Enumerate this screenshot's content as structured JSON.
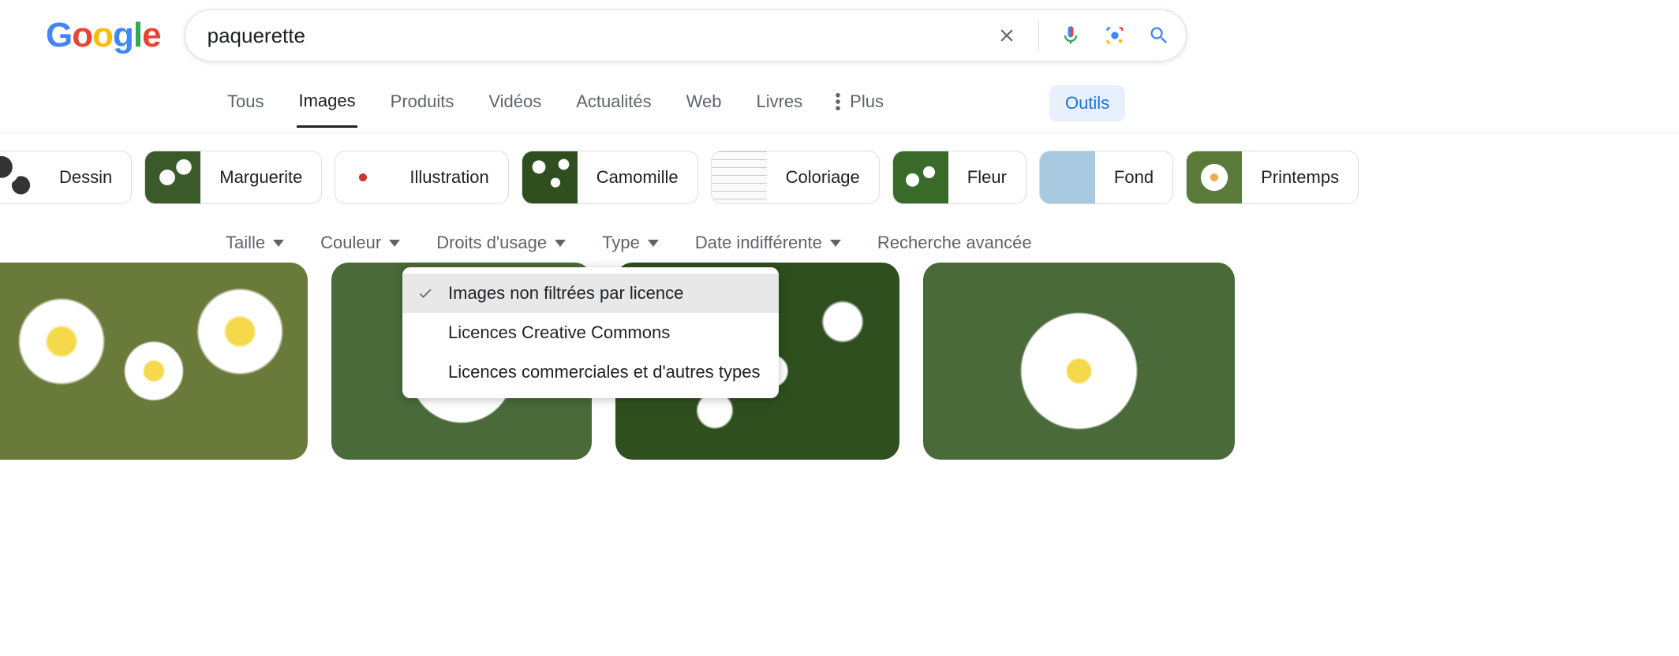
{
  "search": {
    "query": "paquerette"
  },
  "tabs": {
    "all": "Tous",
    "images": "Images",
    "products": "Produits",
    "videos": "Vidéos",
    "news": "Actualités",
    "web": "Web",
    "books": "Livres",
    "more": "Plus",
    "tools": "Outils"
  },
  "chips": [
    {
      "label": "Dessin"
    },
    {
      "label": "Marguerite"
    },
    {
      "label": "Illustration"
    },
    {
      "label": "Camomille"
    },
    {
      "label": "Coloriage"
    },
    {
      "label": "Fleur"
    },
    {
      "label": "Fond"
    },
    {
      "label": "Printemps"
    }
  ],
  "filters": {
    "size": "Taille",
    "color": "Couleur",
    "rights": "Droits d'usage",
    "type": "Type",
    "date": "Date indifférente",
    "advanced": "Recherche avancée"
  },
  "rights_dropdown": {
    "unfiltered": "Images non filtrées par licence",
    "cc": "Licences Creative Commons",
    "commercial": "Licences commerciales et d'autres types"
  }
}
